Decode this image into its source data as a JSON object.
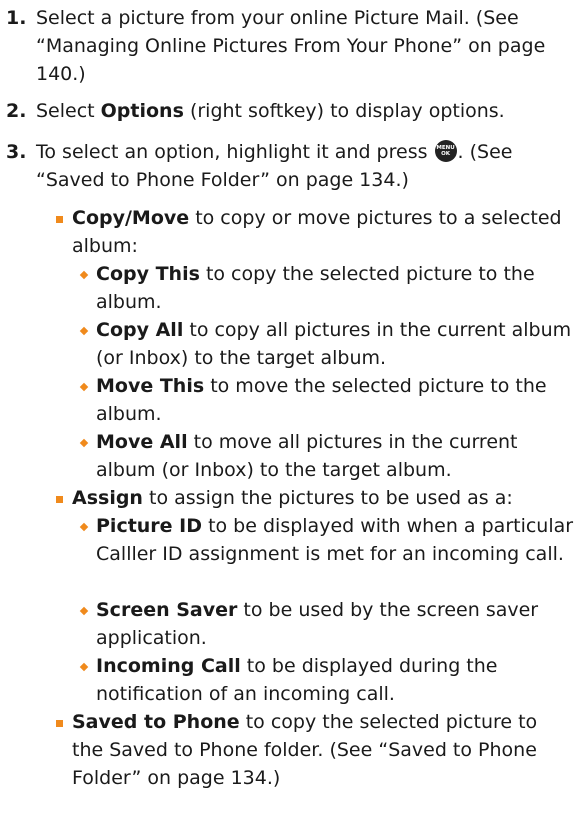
{
  "steps": [
    {
      "num": "1.",
      "text": "Select a picture from your online Picture Mail. (See “Managing Online Pictures From Your Phone” on page 140.)"
    },
    {
      "num": "2.",
      "bold": "Options",
      "pre": "Select ",
      "post": " (right softkey) to display options."
    },
    {
      "num": "3.",
      "pre": "To select an option, highlight it and press ",
      "post": ". (See “Saved to Phone Folder” on page 134.)"
    }
  ],
  "menu_key": {
    "top": "MENU",
    "bottom": "OK",
    "icon": "menu-ok-key-icon"
  },
  "options": [
    {
      "bold": "Copy/Move",
      "text": " to copy or move pictures to a selected album:",
      "sub": [
        {
          "bold": "Copy This",
          "text": " to copy the selected picture to the album."
        },
        {
          "bold": "Copy All",
          "text": " to copy all pictures in the current album (or Inbox) to the target album."
        },
        {
          "bold": "Move This",
          "text": " to move the selected picture to the album."
        },
        {
          "bold": "Move All",
          "text": " to move all pictures in the current album (or Inbox) to the target album."
        }
      ]
    },
    {
      "bold": "Assign",
      "text": " to assign the pictures to be used as a:",
      "sub": [
        {
          "bold": "Picture ID",
          "text": " to be displayed with when a particular Calller ID assignment is met for an incoming call."
        },
        {
          "bold": "Screen Saver",
          "text": " to be used by the screen saver application."
        },
        {
          "bold": "Incoming Call",
          "text": " to be displayed during the notification of an incoming call."
        }
      ]
    },
    {
      "bold": "Saved to Phone",
      "text": " to copy the selected picture to the Saved to Phone folder. (See “Saved to Phone Folder” on page 134.)",
      "sub": []
    }
  ],
  "colors": {
    "bullet": "#f08a1c",
    "text": "#1a1a1a"
  }
}
